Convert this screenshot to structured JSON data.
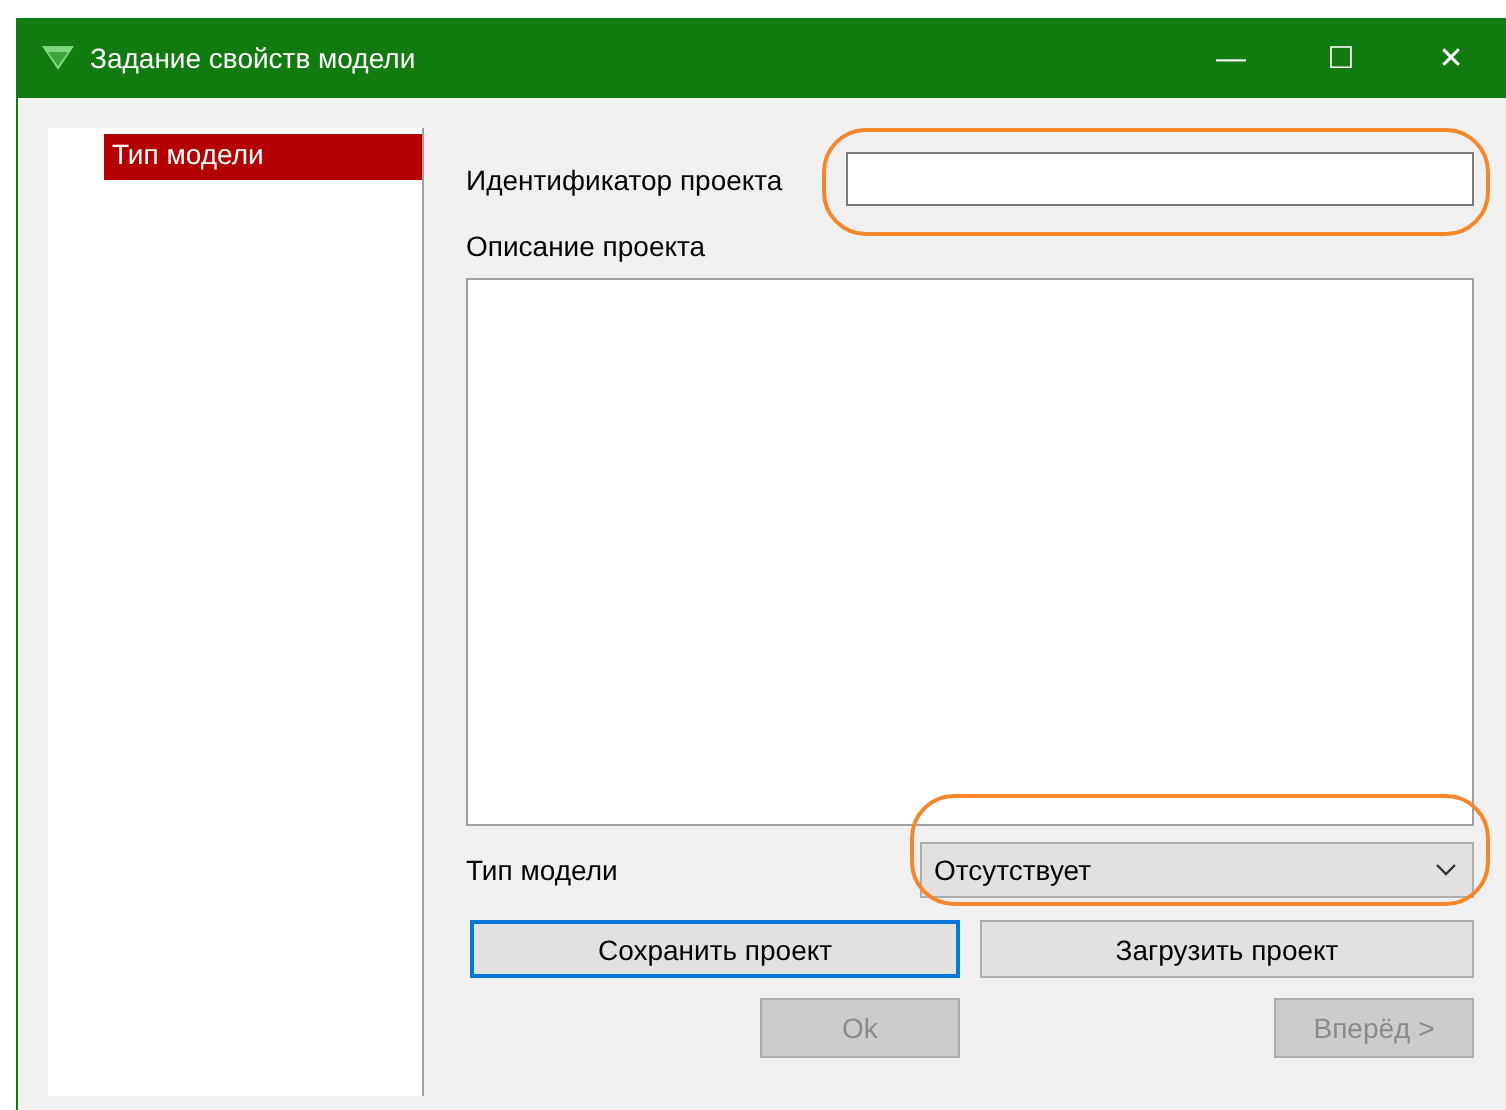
{
  "window": {
    "title": "Задание свойств модели",
    "controls": [
      "—",
      "☐",
      "✕"
    ]
  },
  "tree": {
    "items": [
      {
        "label": "Тип модели",
        "selected": true
      }
    ]
  },
  "form": {
    "id_label": "Идентификатор проекта",
    "id_highlighted": true,
    "type_highlighted": true,
    "description_label": "Описание проекта",
    "type_label": "Тип модели",
    "type_value": "Отсутствует"
  },
  "buttons": [
    {
      "label": "Сохранить проект",
      "focused": true,
      "disabled": false
    },
    {
      "label": "Загрузить проект",
      "focused": false,
      "disabled": false
    }
  ],
  "nav_buttons": [
    {
      "label": "Ok",
      "disabled": true
    },
    {
      "label": "Вперёд >",
      "disabled": true
    }
  ]
}
